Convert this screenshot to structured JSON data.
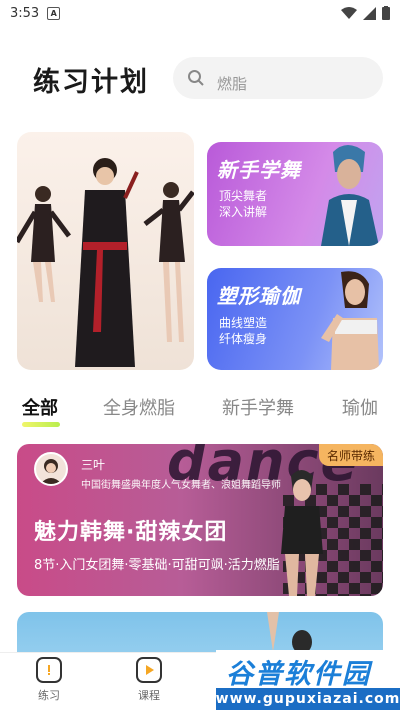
{
  "status_bar": {
    "time": "3:53",
    "notification_icon": "A"
  },
  "header": {
    "title": "练习计划",
    "search_placeholder": "燃脂"
  },
  "banners": {
    "card1": {
      "title": "新手学舞",
      "line1": "顶尖舞者",
      "line2": "深入讲解"
    },
    "card2": {
      "title": "塑形瑜伽",
      "line1": "曲线塑造",
      "line2": "纤体瘦身"
    }
  },
  "tabs": [
    {
      "label": "全部",
      "active": true
    },
    {
      "label": "全身燃脂",
      "active": false
    },
    {
      "label": "新手学舞",
      "active": false
    },
    {
      "label": "瑜伽",
      "active": false
    }
  ],
  "course": {
    "badge": "名师带练",
    "teacher_name": "三叶",
    "teacher_desc": "中国街舞盛典年度人气女舞者、浪姐舞蹈导师",
    "title": "魅力韩舞·甜辣女团",
    "description": "8节·入门女团舞·零基础·可甜可飒·活力燃脂",
    "background_text": "dance"
  },
  "bottom_nav": [
    {
      "label": "练习",
      "icon": "practice-icon"
    },
    {
      "label": "课程",
      "icon": "course-play-icon"
    }
  ],
  "watermark": {
    "brand": "谷普软件园",
    "url": "www.gupuxiazai.com"
  },
  "colors": {
    "accent_tab": "#c6f04f",
    "card1": "#b95ad9",
    "card2": "#4966f0",
    "course": "#c94b88",
    "badge": "#f5b560"
  }
}
